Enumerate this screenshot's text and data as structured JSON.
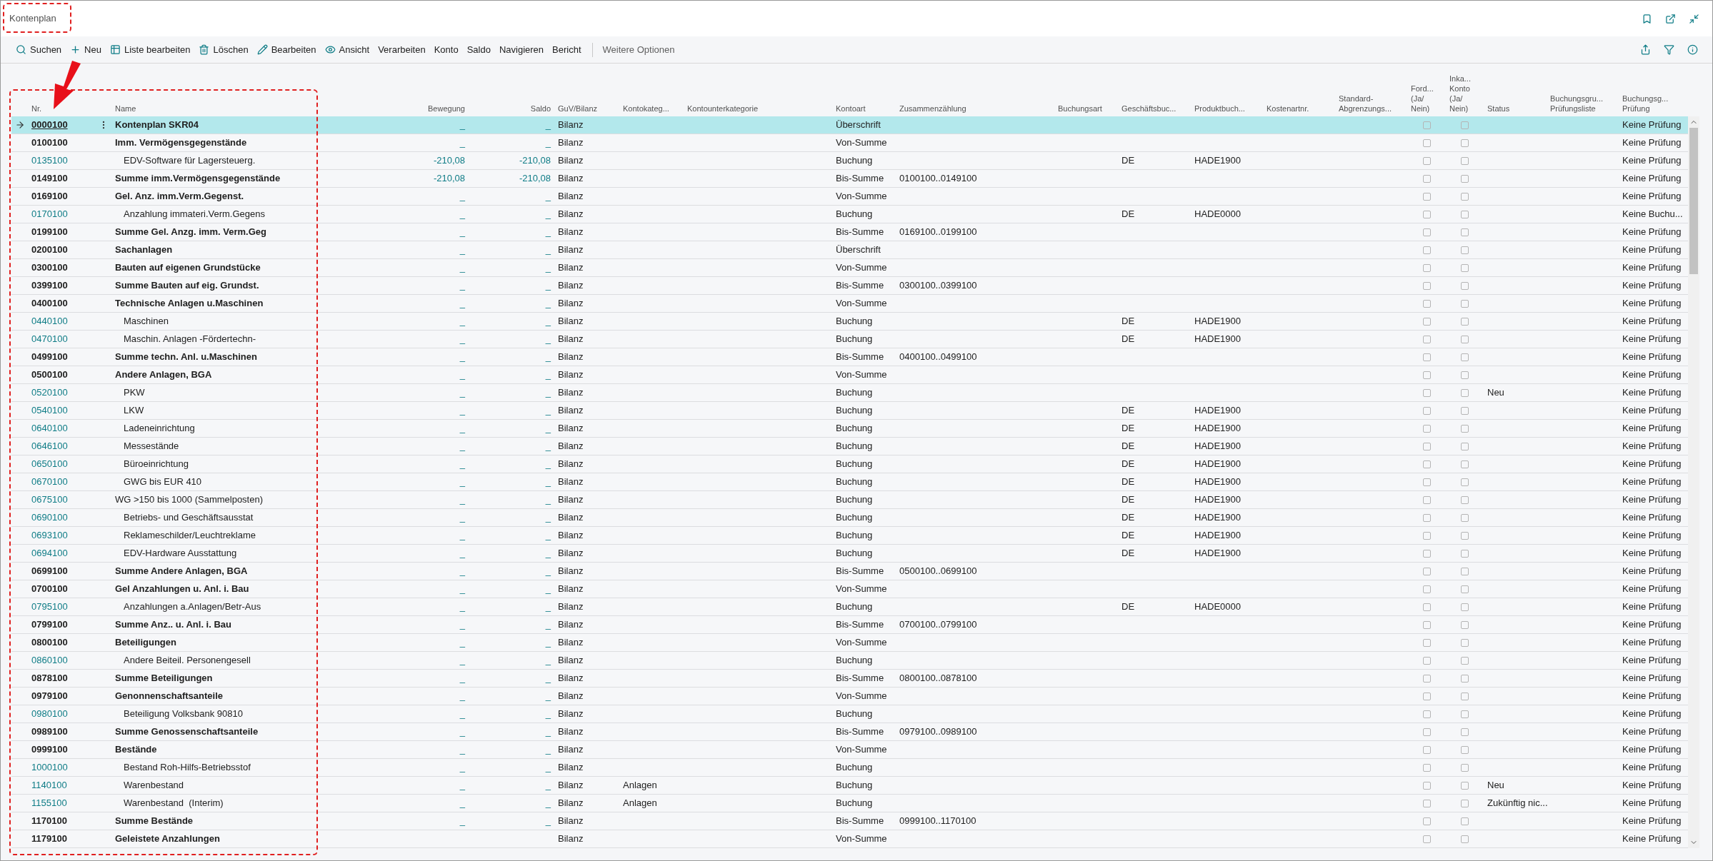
{
  "window": {
    "title": "Kontenplan"
  },
  "toolbar": {
    "actions": [
      {
        "label": "Suchen"
      },
      {
        "label": "Neu"
      },
      {
        "label": "Liste bearbeiten"
      },
      {
        "label": "Löschen"
      },
      {
        "label": "Bearbeiten"
      },
      {
        "label": "Ansicht"
      },
      {
        "label": "Verarbeiten"
      },
      {
        "label": "Konto"
      },
      {
        "label": "Saldo"
      },
      {
        "label": "Navigieren"
      },
      {
        "label": "Bericht"
      }
    ],
    "more": "Weitere Optionen"
  },
  "table": {
    "columns": [
      {
        "lines": [
          "Nr."
        ]
      },
      {
        "lines": [
          "Name"
        ]
      },
      {
        "lines": [
          "Bewegung"
        ]
      },
      {
        "lines": [
          "Saldo"
        ]
      },
      {
        "lines": [
          "GuV/Bilanz"
        ]
      },
      {
        "lines": [
          "Kontokateg..."
        ]
      },
      {
        "lines": [
          "Kontounterkategorie"
        ]
      },
      {
        "lines": [
          "Kontoart"
        ]
      },
      {
        "lines": [
          "Zusammenzählung"
        ]
      },
      {
        "lines": [
          "Buchungsart"
        ]
      },
      {
        "lines": [
          "Geschäftsbuc..."
        ]
      },
      {
        "lines": [
          "Produktbuch..."
        ]
      },
      {
        "lines": [
          "Kostenartnr."
        ]
      },
      {
        "lines": [
          "Standard-",
          "Abgrenzungs..."
        ]
      },
      {
        "lines": [
          "Ford...",
          "(Ja/",
          "Nein)"
        ]
      },
      {
        "lines": [
          "Inka...",
          "Konto",
          "(Ja/",
          "Nein)"
        ]
      },
      {
        "lines": [
          "Status"
        ]
      },
      {
        "lines": [
          "Buchungsgru...",
          "Prüfungsliste"
        ]
      },
      {
        "lines": [
          "Buchungsg...",
          "Prüfung"
        ]
      }
    ],
    "rows": [
      {
        "nr": "0000100",
        "name": "Kontenplan SKR04",
        "bold": true,
        "indented": false,
        "selected": true,
        "bewegung": "_",
        "saldo": "_",
        "guv": "Bilanz",
        "kontoart": "Überschrift",
        "ford": false,
        "inka": false,
        "pruefung": "Keine Prüfung"
      },
      {
        "nr": "0100100",
        "name": "Imm. Vermögensgegenstände",
        "bold": true,
        "indented": false,
        "selected": false,
        "bewegung": "_",
        "saldo": "_",
        "guv": "Bilanz",
        "kontoart": "Von-Summe",
        "ford": false,
        "inka": false,
        "pruefung": "Keine Prüfung"
      },
      {
        "nr": "0135100",
        "name": "EDV-Software für Lagersteuerg.",
        "bold": false,
        "indented": true,
        "selected": false,
        "bewegung": "-210,08",
        "saldo": "-210,08",
        "guv": "Bilanz",
        "kontoart": "Buchung",
        "gesch": "DE",
        "produkt": "HADE1900",
        "ford": false,
        "inka": false,
        "pruefung": "Keine Prüfung"
      },
      {
        "nr": "0149100",
        "name": "Summe imm.Vermögensgegenstände",
        "bold": true,
        "indented": false,
        "selected": false,
        "bewegung": "-210,08",
        "saldo": "-210,08",
        "guv": "Bilanz",
        "kontoart": "Bis-Summe",
        "summe": "0100100..0149100",
        "ford": false,
        "inka": false,
        "pruefung": "Keine Prüfung"
      },
      {
        "nr": "0169100",
        "name": "Gel. Anz. imm.Verm.Gegenst.",
        "bold": true,
        "indented": false,
        "selected": false,
        "bewegung": "_",
        "saldo": "_",
        "guv": "Bilanz",
        "kontoart": "Von-Summe",
        "ford": false,
        "inka": false,
        "pruefung": "Keine Prüfung"
      },
      {
        "nr": "0170100",
        "name": "Anzahlung immateri.Verm.Gegens",
        "bold": false,
        "indented": true,
        "selected": false,
        "bewegung": "_",
        "saldo": "_",
        "guv": "Bilanz",
        "kontoart": "Buchung",
        "gesch": "DE",
        "produkt": "HADE0000",
        "ford": false,
        "inka": false,
        "pruefung": "Keine Buchu..."
      },
      {
        "nr": "0199100",
        "name": "Summe Gel. Anzg. imm. Verm.Geg",
        "bold": true,
        "indented": false,
        "selected": false,
        "bewegung": "_",
        "saldo": "_",
        "guv": "Bilanz",
        "kontoart": "Bis-Summe",
        "summe": "0169100..0199100",
        "ford": false,
        "inka": false,
        "pruefung": "Keine Prüfung"
      },
      {
        "nr": "0200100",
        "name": "Sachanlagen",
        "bold": true,
        "indented": false,
        "selected": false,
        "bewegung": "_",
        "saldo": "_",
        "guv": "Bilanz",
        "kontoart": "Überschrift",
        "ford": false,
        "inka": false,
        "pruefung": "Keine Prüfung"
      },
      {
        "nr": "0300100",
        "name": "Bauten auf eigenen Grundstücke",
        "bold": true,
        "indented": false,
        "selected": false,
        "bewegung": "_",
        "saldo": "_",
        "guv": "Bilanz",
        "kontoart": "Von-Summe",
        "ford": false,
        "inka": false,
        "pruefung": "Keine Prüfung"
      },
      {
        "nr": "0399100",
        "name": "Summe Bauten auf eig. Grundst.",
        "bold": true,
        "indented": false,
        "selected": false,
        "bewegung": "_",
        "saldo": "_",
        "guv": "Bilanz",
        "kontoart": "Bis-Summe",
        "summe": "0300100..0399100",
        "ford": false,
        "inka": false,
        "pruefung": "Keine Prüfung"
      },
      {
        "nr": "0400100",
        "name": "Technische Anlagen u.Maschinen",
        "bold": true,
        "indented": false,
        "selected": false,
        "bewegung": "_",
        "saldo": "_",
        "guv": "Bilanz",
        "kontoart": "Von-Summe",
        "ford": false,
        "inka": false,
        "pruefung": "Keine Prüfung"
      },
      {
        "nr": "0440100",
        "name": "Maschinen",
        "bold": false,
        "indented": true,
        "selected": false,
        "bewegung": "_",
        "saldo": "_",
        "guv": "Bilanz",
        "kontoart": "Buchung",
        "gesch": "DE",
        "produkt": "HADE1900",
        "ford": false,
        "inka": false,
        "pruefung": "Keine Prüfung"
      },
      {
        "nr": "0470100",
        "name": "Maschin. Anlagen -Fördertechn-",
        "bold": false,
        "indented": true,
        "selected": false,
        "bewegung": "_",
        "saldo": "_",
        "guv": "Bilanz",
        "kontoart": "Buchung",
        "gesch": "DE",
        "produkt": "HADE1900",
        "ford": false,
        "inka": false,
        "pruefung": "Keine Prüfung"
      },
      {
        "nr": "0499100",
        "name": "Summe techn. Anl. u.Maschinen",
        "bold": true,
        "indented": false,
        "selected": false,
        "bewegung": "_",
        "saldo": "_",
        "guv": "Bilanz",
        "kontoart": "Bis-Summe",
        "summe": "0400100..0499100",
        "ford": false,
        "inka": false,
        "pruefung": "Keine Prüfung"
      },
      {
        "nr": "0500100",
        "name": "Andere Anlagen, BGA",
        "bold": true,
        "indented": false,
        "selected": false,
        "bewegung": "_",
        "saldo": "_",
        "guv": "Bilanz",
        "kontoart": "Von-Summe",
        "ford": false,
        "inka": false,
        "pruefung": "Keine Prüfung"
      },
      {
        "nr": "0520100",
        "name": "PKW",
        "bold": false,
        "indented": true,
        "selected": false,
        "bewegung": "_",
        "saldo": "_",
        "guv": "Bilanz",
        "kontoart": "Buchung",
        "ford": false,
        "inka": false,
        "status": "Neu",
        "pruefung": "Keine Prüfung"
      },
      {
        "nr": "0540100",
        "name": "LKW",
        "bold": false,
        "indented": true,
        "selected": false,
        "bewegung": "_",
        "saldo": "_",
        "guv": "Bilanz",
        "kontoart": "Buchung",
        "gesch": "DE",
        "produkt": "HADE1900",
        "ford": false,
        "inka": false,
        "pruefung": "Keine Prüfung"
      },
      {
        "nr": "0640100",
        "name": "Ladeneinrichtung",
        "bold": false,
        "indented": true,
        "selected": false,
        "bewegung": "_",
        "saldo": "_",
        "guv": "Bilanz",
        "kontoart": "Buchung",
        "gesch": "DE",
        "produkt": "HADE1900",
        "ford": false,
        "inka": false,
        "pruefung": "Keine Prüfung"
      },
      {
        "nr": "0646100",
        "name": "Messestände",
        "bold": false,
        "indented": true,
        "selected": false,
        "bewegung": "_",
        "saldo": "_",
        "guv": "Bilanz",
        "kontoart": "Buchung",
        "gesch": "DE",
        "produkt": "HADE1900",
        "ford": false,
        "inka": false,
        "pruefung": "Keine Prüfung"
      },
      {
        "nr": "0650100",
        "name": "Büroeinrichtung",
        "bold": false,
        "indented": true,
        "selected": false,
        "bewegung": "_",
        "saldo": "_",
        "guv": "Bilanz",
        "kontoart": "Buchung",
        "gesch": "DE",
        "produkt": "HADE1900",
        "ford": false,
        "inka": false,
        "pruefung": "Keine Prüfung"
      },
      {
        "nr": "0670100",
        "name": "GWG bis EUR 410",
        "bold": false,
        "indented": true,
        "selected": false,
        "bewegung": "_",
        "saldo": "_",
        "guv": "Bilanz",
        "kontoart": "Buchung",
        "gesch": "DE",
        "produkt": "HADE1900",
        "ford": false,
        "inka": false,
        "pruefung": "Keine Prüfung"
      },
      {
        "nr": "0675100",
        "name": "WG >150 bis 1000 (Sammelposten)",
        "bold": false,
        "indented": false,
        "selected": false,
        "bewegung": "_",
        "saldo": "_",
        "guv": "Bilanz",
        "kontoart": "Buchung",
        "gesch": "DE",
        "produkt": "HADE1900",
        "ford": false,
        "inka": false,
        "pruefung": "Keine Prüfung"
      },
      {
        "nr": "0690100",
        "name": "Betriebs- und Geschäftsausstat",
        "bold": false,
        "indented": true,
        "selected": false,
        "bewegung": "_",
        "saldo": "_",
        "guv": "Bilanz",
        "kontoart": "Buchung",
        "gesch": "DE",
        "produkt": "HADE1900",
        "ford": false,
        "inka": false,
        "pruefung": "Keine Prüfung"
      },
      {
        "nr": "0693100",
        "name": "Reklameschilder/Leuchtreklame",
        "bold": false,
        "indented": true,
        "selected": false,
        "bewegung": "_",
        "saldo": "_",
        "guv": "Bilanz",
        "kontoart": "Buchung",
        "gesch": "DE",
        "produkt": "HADE1900",
        "ford": false,
        "inka": false,
        "pruefung": "Keine Prüfung"
      },
      {
        "nr": "0694100",
        "name": "EDV-Hardware Ausstattung",
        "bold": false,
        "indented": true,
        "selected": false,
        "bewegung": "_",
        "saldo": "_",
        "guv": "Bilanz",
        "kontoart": "Buchung",
        "gesch": "DE",
        "produkt": "HADE1900",
        "ford": false,
        "inka": false,
        "pruefung": "Keine Prüfung"
      },
      {
        "nr": "0699100",
        "name": "Summe Andere Anlagen, BGA",
        "bold": true,
        "indented": false,
        "selected": false,
        "bewegung": "_",
        "saldo": "_",
        "guv": "Bilanz",
        "kontoart": "Bis-Summe",
        "summe": "0500100..0699100",
        "ford": false,
        "inka": false,
        "pruefung": "Keine Prüfung"
      },
      {
        "nr": "0700100",
        "name": "Gel Anzahlungen u. Anl. i. Bau",
        "bold": true,
        "indented": false,
        "selected": false,
        "bewegung": "_",
        "saldo": "_",
        "guv": "Bilanz",
        "kontoart": "Von-Summe",
        "ford": false,
        "inka": false,
        "pruefung": "Keine Prüfung"
      },
      {
        "nr": "0795100",
        "name": "Anzahlungen a.Anlagen/Betr-Aus",
        "bold": false,
        "indented": true,
        "selected": false,
        "bewegung": "_",
        "saldo": "_",
        "guv": "Bilanz",
        "kontoart": "Buchung",
        "gesch": "DE",
        "produkt": "HADE0000",
        "ford": false,
        "inka": false,
        "pruefung": "Keine Prüfung"
      },
      {
        "nr": "0799100",
        "name": "Summe Anz.. u. Anl. i. Bau",
        "bold": true,
        "indented": false,
        "selected": false,
        "bewegung": "_",
        "saldo": "_",
        "guv": "Bilanz",
        "kontoart": "Bis-Summe",
        "summe": "0700100..0799100",
        "ford": false,
        "inka": false,
        "pruefung": "Keine Prüfung"
      },
      {
        "nr": "0800100",
        "name": "Beteiligungen",
        "bold": true,
        "indented": false,
        "selected": false,
        "bewegung": "_",
        "saldo": "_",
        "guv": "Bilanz",
        "kontoart": "Von-Summe",
        "ford": false,
        "inka": false,
        "pruefung": "Keine Prüfung"
      },
      {
        "nr": "0860100",
        "name": "Andere Beiteil. Personengesell",
        "bold": false,
        "indented": true,
        "selected": false,
        "bewegung": "_",
        "saldo": "_",
        "guv": "Bilanz",
        "kontoart": "Buchung",
        "ford": false,
        "inka": false,
        "pruefung": "Keine Prüfung"
      },
      {
        "nr": "0878100",
        "name": "Summe Beteiligungen",
        "bold": true,
        "indented": false,
        "selected": false,
        "bewegung": "_",
        "saldo": "_",
        "guv": "Bilanz",
        "kontoart": "Bis-Summe",
        "summe": "0800100..0878100",
        "ford": false,
        "inka": false,
        "pruefung": "Keine Prüfung"
      },
      {
        "nr": "0979100",
        "name": "Genonnenschaftsanteile",
        "bold": true,
        "indented": false,
        "selected": false,
        "bewegung": "_",
        "saldo": "_",
        "guv": "Bilanz",
        "kontoart": "Von-Summe",
        "ford": false,
        "inka": false,
        "pruefung": "Keine Prüfung"
      },
      {
        "nr": "0980100",
        "name": "Beteiligung Volksbank 90810",
        "bold": false,
        "indented": true,
        "selected": false,
        "bewegung": "_",
        "saldo": "_",
        "guv": "Bilanz",
        "kontoart": "Buchung",
        "ford": false,
        "inka": false,
        "pruefung": "Keine Prüfung"
      },
      {
        "nr": "0989100",
        "name": "Summe Genossenschaftsanteile",
        "bold": true,
        "indented": false,
        "selected": false,
        "bewegung": "_",
        "saldo": "_",
        "guv": "Bilanz",
        "kontoart": "Bis-Summe",
        "summe": "0979100..0989100",
        "ford": false,
        "inka": false,
        "pruefung": "Keine Prüfung"
      },
      {
        "nr": "0999100",
        "name": "Bestände",
        "bold": true,
        "indented": false,
        "selected": false,
        "bewegung": "_",
        "saldo": "_",
        "guv": "Bilanz",
        "kontoart": "Von-Summe",
        "ford": false,
        "inka": false,
        "pruefung": "Keine Prüfung"
      },
      {
        "nr": "1000100",
        "name": "Bestand Roh-Hilfs-Betriebsstof",
        "bold": false,
        "indented": true,
        "selected": false,
        "bewegung": "_",
        "saldo": "_",
        "guv": "Bilanz",
        "kontoart": "Buchung",
        "ford": false,
        "inka": false,
        "pruefung": "Keine Prüfung"
      },
      {
        "nr": "1140100",
        "name": "Warenbestand",
        "bold": false,
        "indented": true,
        "selected": false,
        "bewegung": "_",
        "saldo": "_",
        "guv": "Bilanz",
        "kategorie": "Anlagen",
        "kontoart": "Buchung",
        "ford": false,
        "inka": false,
        "status": "Neu",
        "pruefung": "Keine Prüfung"
      },
      {
        "nr": "1155100",
        "name": "Warenbestand  (Interim)",
        "bold": false,
        "indented": true,
        "selected": false,
        "bewegung": "_",
        "saldo": "_",
        "guv": "Bilanz",
        "kategorie": "Anlagen",
        "kontoart": "Buchung",
        "ford": false,
        "inka": false,
        "status": "Zukünftig nic...",
        "pruefung": "Keine Prüfung"
      },
      {
        "nr": "1170100",
        "name": "Summe Bestände",
        "bold": true,
        "indented": false,
        "selected": false,
        "bewegung": "_",
        "saldo": "_",
        "guv": "Bilanz",
        "kontoart": "Bis-Summe",
        "summe": "0999100..1170100",
        "ford": false,
        "inka": false,
        "pruefung": "Keine Prüfung"
      },
      {
        "nr": "1179100",
        "name": "Geleistete Anzahlungen",
        "bold": true,
        "indented": false,
        "selected": false,
        "guv": "Bilanz",
        "kontoart": "Von-Summe",
        "ford": false,
        "inka": false,
        "pruefung": "Keine Prüfung"
      }
    ]
  }
}
